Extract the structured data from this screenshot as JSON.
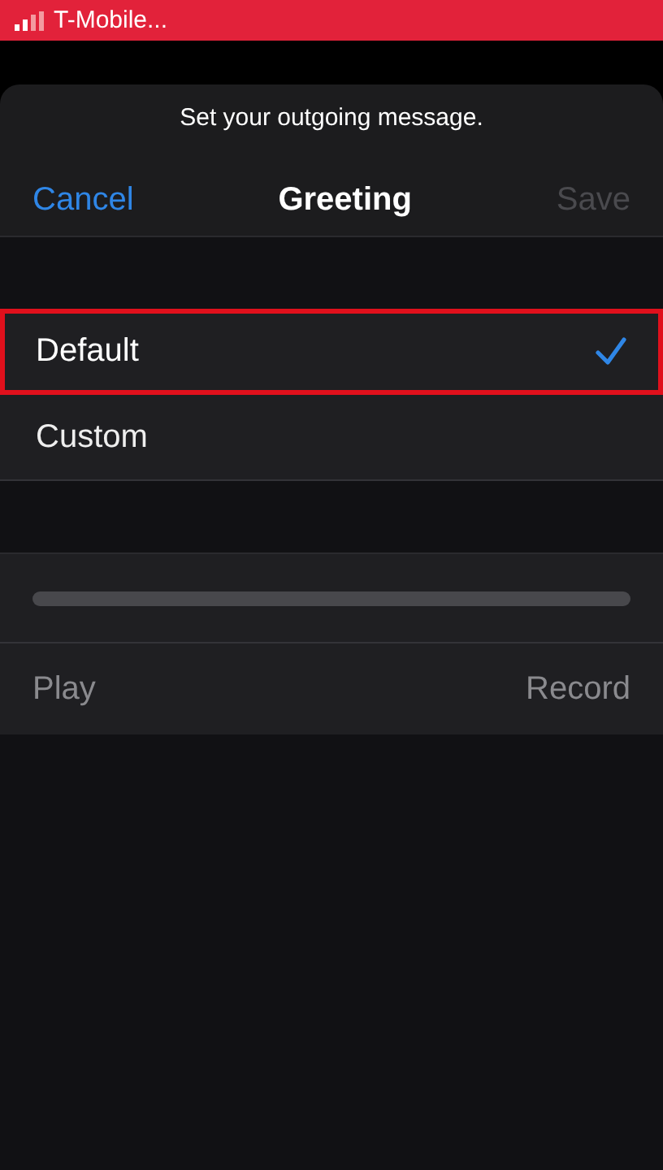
{
  "status_bar": {
    "carrier": "T-Mobile..."
  },
  "sheet": {
    "prompt": "Set your outgoing message.",
    "nav": {
      "cancel": "Cancel",
      "title": "Greeting",
      "save": {
        "label": "Save",
        "disabled": true
      }
    }
  },
  "options": [
    {
      "label": "Default",
      "selected": true,
      "highlighted": true
    },
    {
      "label": "Custom",
      "selected": false,
      "highlighted": false
    }
  ],
  "player": {
    "level": 0,
    "play": {
      "label": "Play",
      "disabled": true
    },
    "record": {
      "label": "Record",
      "disabled": true
    }
  }
}
